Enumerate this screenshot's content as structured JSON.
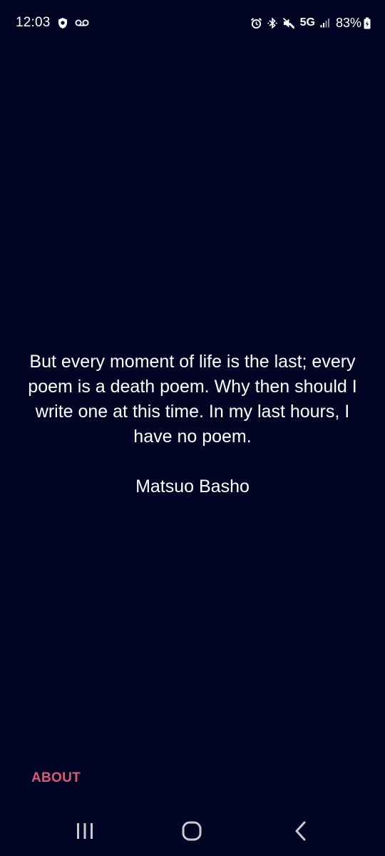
{
  "status_bar": {
    "time": "12:03",
    "network": "5G",
    "battery": "83%",
    "left_icons": [
      "shield-icon",
      "voicemail-icon"
    ],
    "right_icons": [
      "alarm-icon",
      "bluetooth-icon",
      "mute-icon",
      "signal-icon",
      "battery-icon"
    ]
  },
  "quote": {
    "text": "But every moment of life is the last; every poem is a death poem. Why then should I write one at this time. In my last hours, I have no poem.",
    "author": "Matsuo Basho"
  },
  "footer": {
    "about_label": "ABOUT"
  },
  "nav": [
    "recents-icon",
    "home-icon",
    "back-icon"
  ],
  "colors": {
    "background": "#020624",
    "text": "#ffffff",
    "accent": "#d95c74"
  }
}
